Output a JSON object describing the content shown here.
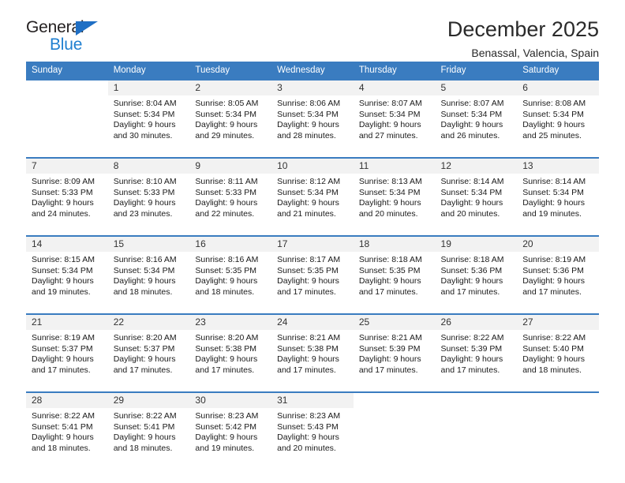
{
  "brand": {
    "name_part1": "General",
    "name_part2": "Blue",
    "triangle_icon": "triangle-icon",
    "accent_color": "#1f7fd0"
  },
  "header": {
    "title": "December 2025",
    "subtitle": "Benassal, Valencia, Spain"
  },
  "calendar": {
    "header_bg": "#3a7cc0",
    "daynum_bg": "#f2f2f2",
    "weekdays": [
      "Sunday",
      "Monday",
      "Tuesday",
      "Wednesday",
      "Thursday",
      "Friday",
      "Saturday"
    ],
    "weeks": [
      [
        {
          "day": "",
          "lines": []
        },
        {
          "day": "1",
          "lines": [
            "Sunrise: 8:04 AM",
            "Sunset: 5:34 PM",
            "Daylight: 9 hours",
            "and 30 minutes."
          ]
        },
        {
          "day": "2",
          "lines": [
            "Sunrise: 8:05 AM",
            "Sunset: 5:34 PM",
            "Daylight: 9 hours",
            "and 29 minutes."
          ]
        },
        {
          "day": "3",
          "lines": [
            "Sunrise: 8:06 AM",
            "Sunset: 5:34 PM",
            "Daylight: 9 hours",
            "and 28 minutes."
          ]
        },
        {
          "day": "4",
          "lines": [
            "Sunrise: 8:07 AM",
            "Sunset: 5:34 PM",
            "Daylight: 9 hours",
            "and 27 minutes."
          ]
        },
        {
          "day": "5",
          "lines": [
            "Sunrise: 8:07 AM",
            "Sunset: 5:34 PM",
            "Daylight: 9 hours",
            "and 26 minutes."
          ]
        },
        {
          "day": "6",
          "lines": [
            "Sunrise: 8:08 AM",
            "Sunset: 5:34 PM",
            "Daylight: 9 hours",
            "and 25 minutes."
          ]
        }
      ],
      [
        {
          "day": "7",
          "lines": [
            "Sunrise: 8:09 AM",
            "Sunset: 5:33 PM",
            "Daylight: 9 hours",
            "and 24 minutes."
          ]
        },
        {
          "day": "8",
          "lines": [
            "Sunrise: 8:10 AM",
            "Sunset: 5:33 PM",
            "Daylight: 9 hours",
            "and 23 minutes."
          ]
        },
        {
          "day": "9",
          "lines": [
            "Sunrise: 8:11 AM",
            "Sunset: 5:33 PM",
            "Daylight: 9 hours",
            "and 22 minutes."
          ]
        },
        {
          "day": "10",
          "lines": [
            "Sunrise: 8:12 AM",
            "Sunset: 5:34 PM",
            "Daylight: 9 hours",
            "and 21 minutes."
          ]
        },
        {
          "day": "11",
          "lines": [
            "Sunrise: 8:13 AM",
            "Sunset: 5:34 PM",
            "Daylight: 9 hours",
            "and 20 minutes."
          ]
        },
        {
          "day": "12",
          "lines": [
            "Sunrise: 8:14 AM",
            "Sunset: 5:34 PM",
            "Daylight: 9 hours",
            "and 20 minutes."
          ]
        },
        {
          "day": "13",
          "lines": [
            "Sunrise: 8:14 AM",
            "Sunset: 5:34 PM",
            "Daylight: 9 hours",
            "and 19 minutes."
          ]
        }
      ],
      [
        {
          "day": "14",
          "lines": [
            "Sunrise: 8:15 AM",
            "Sunset: 5:34 PM",
            "Daylight: 9 hours",
            "and 19 minutes."
          ]
        },
        {
          "day": "15",
          "lines": [
            "Sunrise: 8:16 AM",
            "Sunset: 5:34 PM",
            "Daylight: 9 hours",
            "and 18 minutes."
          ]
        },
        {
          "day": "16",
          "lines": [
            "Sunrise: 8:16 AM",
            "Sunset: 5:35 PM",
            "Daylight: 9 hours",
            "and 18 minutes."
          ]
        },
        {
          "day": "17",
          "lines": [
            "Sunrise: 8:17 AM",
            "Sunset: 5:35 PM",
            "Daylight: 9 hours",
            "and 17 minutes."
          ]
        },
        {
          "day": "18",
          "lines": [
            "Sunrise: 8:18 AM",
            "Sunset: 5:35 PM",
            "Daylight: 9 hours",
            "and 17 minutes."
          ]
        },
        {
          "day": "19",
          "lines": [
            "Sunrise: 8:18 AM",
            "Sunset: 5:36 PM",
            "Daylight: 9 hours",
            "and 17 minutes."
          ]
        },
        {
          "day": "20",
          "lines": [
            "Sunrise: 8:19 AM",
            "Sunset: 5:36 PM",
            "Daylight: 9 hours",
            "and 17 minutes."
          ]
        }
      ],
      [
        {
          "day": "21",
          "lines": [
            "Sunrise: 8:19 AM",
            "Sunset: 5:37 PM",
            "Daylight: 9 hours",
            "and 17 minutes."
          ]
        },
        {
          "day": "22",
          "lines": [
            "Sunrise: 8:20 AM",
            "Sunset: 5:37 PM",
            "Daylight: 9 hours",
            "and 17 minutes."
          ]
        },
        {
          "day": "23",
          "lines": [
            "Sunrise: 8:20 AM",
            "Sunset: 5:38 PM",
            "Daylight: 9 hours",
            "and 17 minutes."
          ]
        },
        {
          "day": "24",
          "lines": [
            "Sunrise: 8:21 AM",
            "Sunset: 5:38 PM",
            "Daylight: 9 hours",
            "and 17 minutes."
          ]
        },
        {
          "day": "25",
          "lines": [
            "Sunrise: 8:21 AM",
            "Sunset: 5:39 PM",
            "Daylight: 9 hours",
            "and 17 minutes."
          ]
        },
        {
          "day": "26",
          "lines": [
            "Sunrise: 8:22 AM",
            "Sunset: 5:39 PM",
            "Daylight: 9 hours",
            "and 17 minutes."
          ]
        },
        {
          "day": "27",
          "lines": [
            "Sunrise: 8:22 AM",
            "Sunset: 5:40 PM",
            "Daylight: 9 hours",
            "and 18 minutes."
          ]
        }
      ],
      [
        {
          "day": "28",
          "lines": [
            "Sunrise: 8:22 AM",
            "Sunset: 5:41 PM",
            "Daylight: 9 hours",
            "and 18 minutes."
          ]
        },
        {
          "day": "29",
          "lines": [
            "Sunrise: 8:22 AM",
            "Sunset: 5:41 PM",
            "Daylight: 9 hours",
            "and 18 minutes."
          ]
        },
        {
          "day": "30",
          "lines": [
            "Sunrise: 8:23 AM",
            "Sunset: 5:42 PM",
            "Daylight: 9 hours",
            "and 19 minutes."
          ]
        },
        {
          "day": "31",
          "lines": [
            "Sunrise: 8:23 AM",
            "Sunset: 5:43 PM",
            "Daylight: 9 hours",
            "and 20 minutes."
          ]
        },
        {
          "day": "",
          "lines": []
        },
        {
          "day": "",
          "lines": []
        },
        {
          "day": "",
          "lines": []
        }
      ]
    ]
  }
}
